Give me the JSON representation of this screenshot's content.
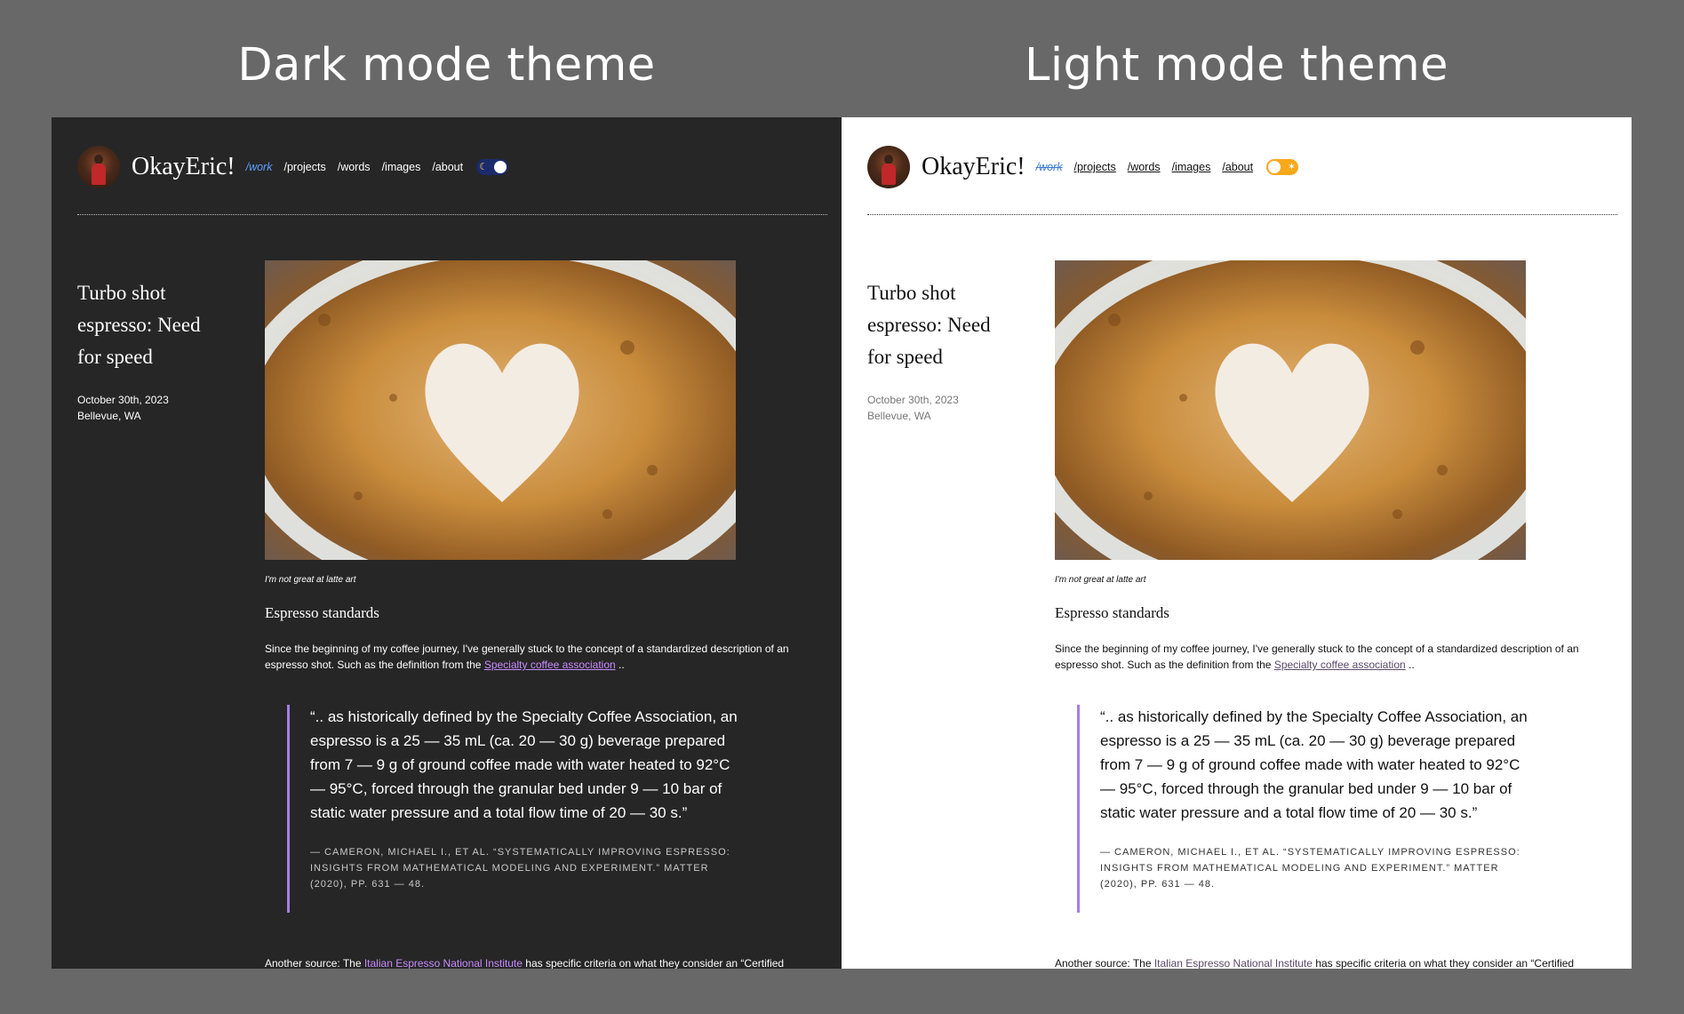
{
  "labels": {
    "dark": "Dark mode theme",
    "light": "Light mode theme"
  },
  "site": {
    "title": "OkayEric!",
    "nav": [
      "/work",
      "/projects",
      "/words",
      "/images",
      "/about"
    ]
  },
  "toggle": {
    "moon_icon": "☾",
    "sun_icon": "✶"
  },
  "post": {
    "title": "Turbo shot espresso: Need for speed",
    "date": "October 30th, 2023",
    "location": "Bellevue, WA",
    "image_caption": "I'm not great at latte art",
    "section_heading": "Espresso standards",
    "intro_text": "Since the beginning of my coffee journey, I've generally stuck to the concept of a standardized description of an espresso shot. Such as the definition from the ",
    "intro_link": "Specialty coffee association",
    "intro_after": " ..",
    "quote": "“.. as historically defined by the Specialty Coffee Association, an espresso is a 25 — 35 mL (ca. 20 — 30 g) beverage prepared from 7 — 9 g of ground coffee made with water heated to 92°C — 95°C, forced through the granular bed under 9 — 10 bar of static water pressure and a total flow time of 20 — 30 s.”",
    "citation": "— Cameron, Michael I., et al. “Systematically improving espresso: Insights from mathematical modeling and experiment.” Matter (2020), pp. 631 — 48.",
    "source_prefix": "Another source: The ",
    "source_link": "Italian Espresso National Institute",
    "source_after": " has specific criteria on what they consider an “Certified"
  },
  "colors": {
    "dark_bg": "#262626",
    "light_bg": "#ffffff",
    "quote_bar": "#a57ee8",
    "active_nav": "#5ea0ff",
    "toggle_dark": "#1b2a6b",
    "toggle_light": "#f7a81b"
  }
}
